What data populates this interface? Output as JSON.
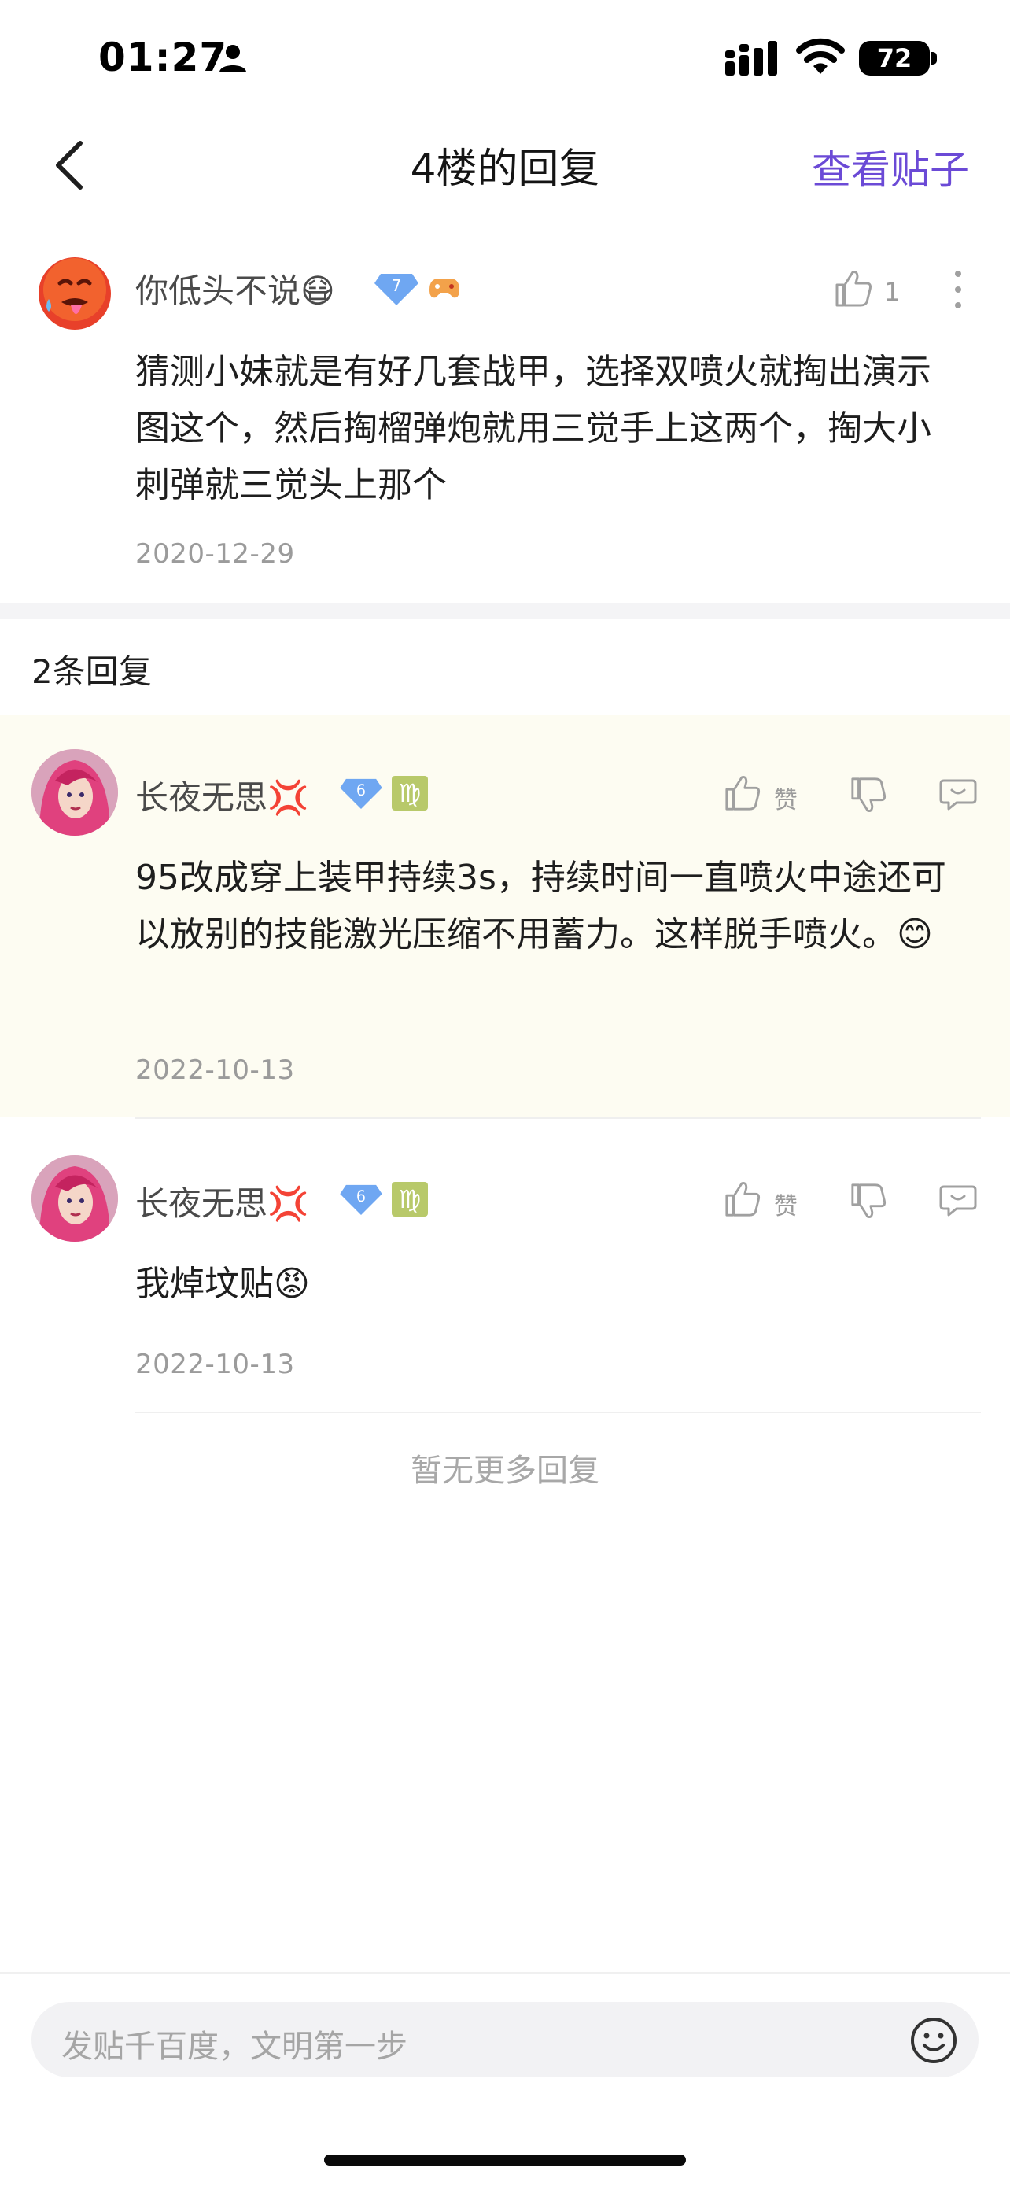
{
  "status_bar": {
    "time": "01:27",
    "battery": "72"
  },
  "nav": {
    "title": "4楼的回复",
    "view_post": "查看贴子"
  },
  "main_post": {
    "username": "你低头不说😷",
    "level_badge": "7",
    "body": "猜测小妹就是有好几套战甲，选择双喷火就掏出演示图这个，然后掏榴弹炮就用三觉手上这两个，掏大小刺弹就三觉头上那个",
    "date": "2020-12-29",
    "like_count": "1"
  },
  "reply_count": "2条回复",
  "replies": [
    {
      "username": "长夜无思💢",
      "level_badge": "6",
      "zodiac": "♍",
      "body": "95改成穿上装甲持续3s，持续时间一直喷火中途还可以放别的技能激光压缩不用蓄力。这样脱手喷火。😊",
      "date": "2022-10-13",
      "like_label": "赞"
    },
    {
      "username": "长夜无思💢",
      "level_badge": "6",
      "zodiac": "♍",
      "body": "我焯坟贴😡",
      "date": "2022-10-13",
      "like_label": "赞"
    }
  ],
  "no_more": "暂无更多回复",
  "input": {
    "placeholder": "发贴千百度，文明第一步"
  },
  "colors": {
    "accent": "#6b4ad6",
    "highlight_bg": "#fdfcf2",
    "muted": "#9b9b9b"
  }
}
